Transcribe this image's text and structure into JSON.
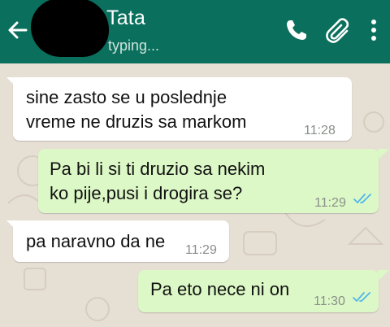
{
  "header": {
    "contact_name": "Tata",
    "status": "typing...",
    "colors": {
      "bar": "#0a6f5c",
      "status_text": "#cfe3dd"
    },
    "icons": [
      "back-arrow-icon",
      "phone-icon",
      "paperclip-icon",
      "more-vert-icon"
    ]
  },
  "messages": [
    {
      "direction": "incoming",
      "line1": "sine zasto se u poslednje",
      "line2": "vreme ne druzis sa markom",
      "time": "11:28"
    },
    {
      "direction": "outgoing",
      "line1": "Pa bi li si ti druzio sa nekim",
      "line2": "ko pije,pusi i drogira se?",
      "time": "11:29",
      "status_icon": "double-check-read-icon"
    },
    {
      "direction": "incoming",
      "line1": "pa naravno da ne",
      "time": "11:29"
    },
    {
      "direction": "outgoing",
      "line1": "Pa eto nece ni on",
      "time": "11:30",
      "status_icon": "double-check-read-icon"
    }
  ],
  "colors": {
    "chat_background": "#e6dfd4",
    "incoming_bubble": "#ffffff",
    "outgoing_bubble": "#dcf8c6",
    "read_ticks": "#4fb6ec"
  }
}
